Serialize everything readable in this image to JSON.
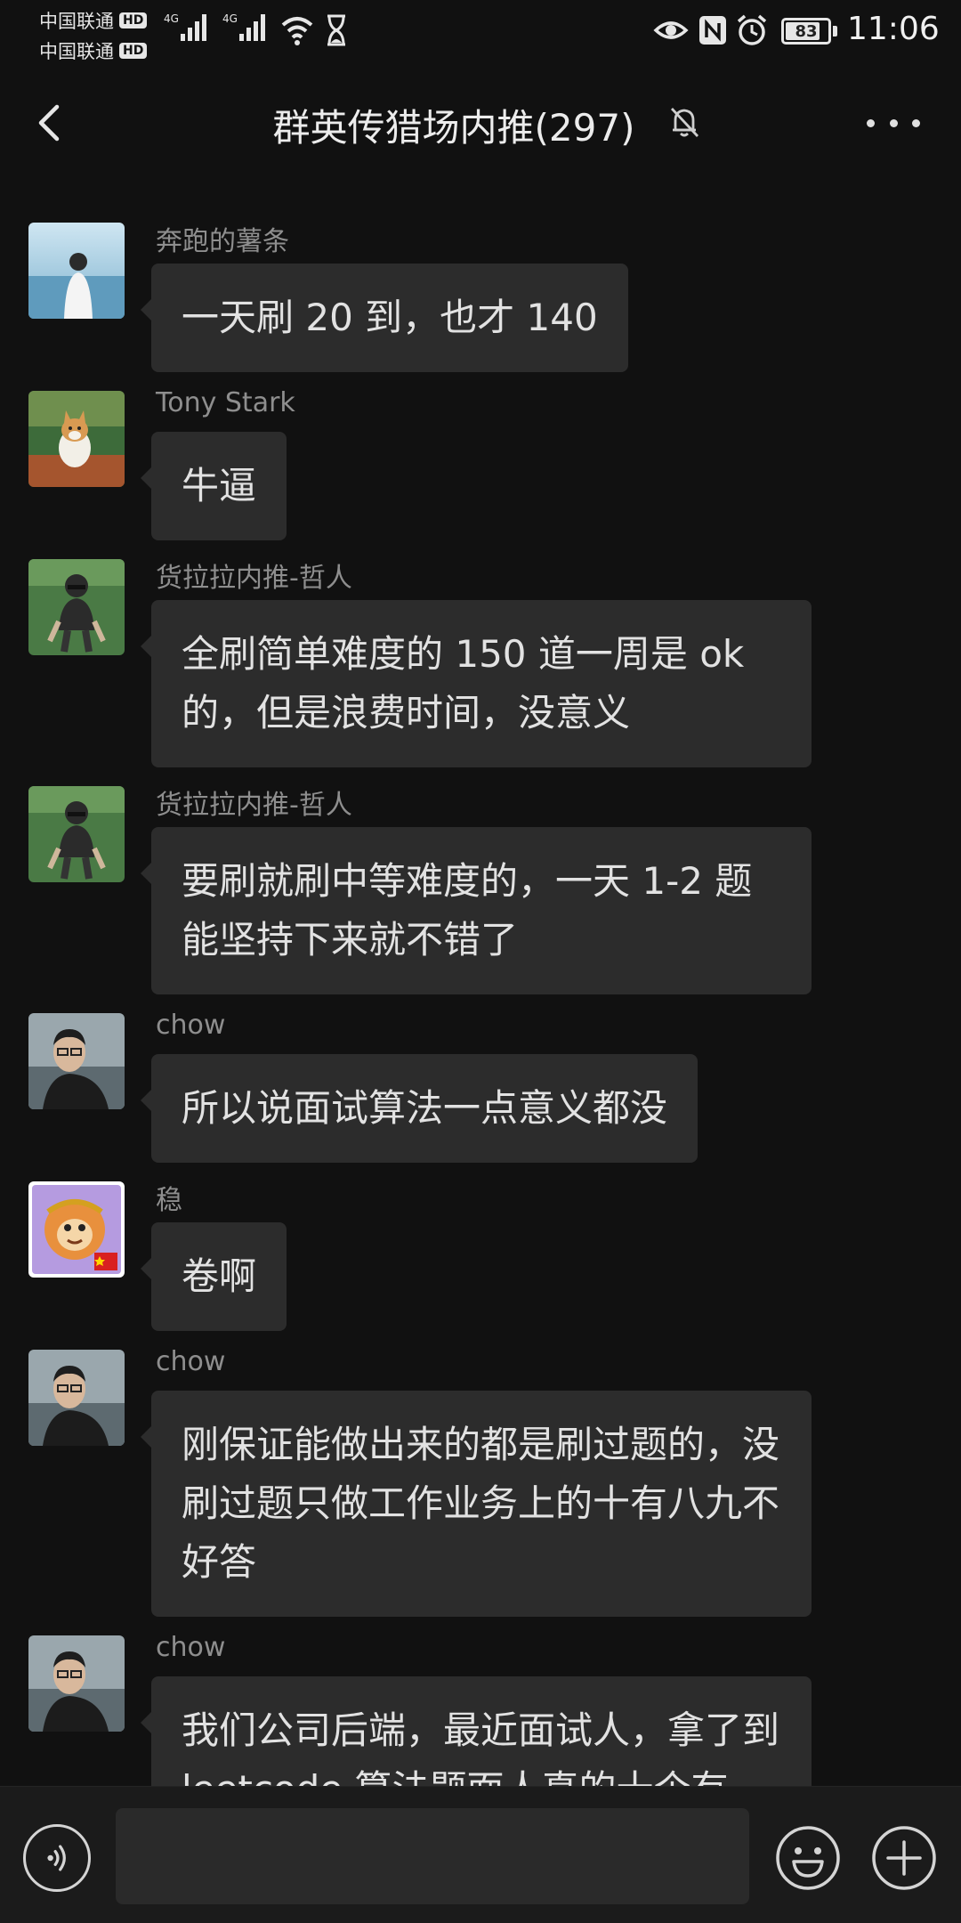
{
  "status_bar": {
    "carrier_1": "中国联通",
    "carrier_2": "中国联通",
    "hd_badge": "HD",
    "network_1": "4G",
    "network_2": "4G",
    "battery_level": "83",
    "battery_fraction": 0.83,
    "time": "11:06"
  },
  "nav": {
    "title": "群英传猎场内推(297)",
    "back_icon": "chevron-left-icon",
    "mute_icon": "bell-off-icon",
    "more_icon": "more-dots-icon"
  },
  "messages": [
    {
      "sender": "奔跑的薯条",
      "text": "一天刷 20 到，也才 140",
      "avatar": "photo-person-seaside"
    },
    {
      "sender": "Tony Stark",
      "text": "牛逼",
      "avatar": "photo-corgi-dog"
    },
    {
      "sender": "货拉拉内推-哲人",
      "text": "全刷简单难度的 150 道一周是 ok 的，但是浪费时间，没意义",
      "avatar": "photo-person-on-grass"
    },
    {
      "sender": "货拉拉内推-哲人",
      "text": "要刷就刷中等难度的，一天 1-2 题能坚持下来就不错了",
      "avatar": "photo-person-on-grass"
    },
    {
      "sender": "chow",
      "text": "所以说面试算法一点意义都没",
      "avatar": "photo-man-glasses"
    },
    {
      "sender": "稳",
      "text": "卷啊",
      "avatar": "cartoon-monkey-king"
    },
    {
      "sender": "chow",
      "text": "刚保证能做出来的都是刷过题的，没刷过题只做工作业务上的十有八九不好答",
      "avatar": "photo-man-glasses"
    },
    {
      "sender": "chow",
      "text": "我们公司后端，最近面试人，拿了到 leetcode 算法题面人真的十个有",
      "avatar": "photo-man-glasses"
    }
  ],
  "input_bar": {
    "voice_icon": "voice-icon",
    "input_value": "",
    "emoji_icon": "smiley-icon",
    "plus_icon": "plus-circle-icon"
  }
}
